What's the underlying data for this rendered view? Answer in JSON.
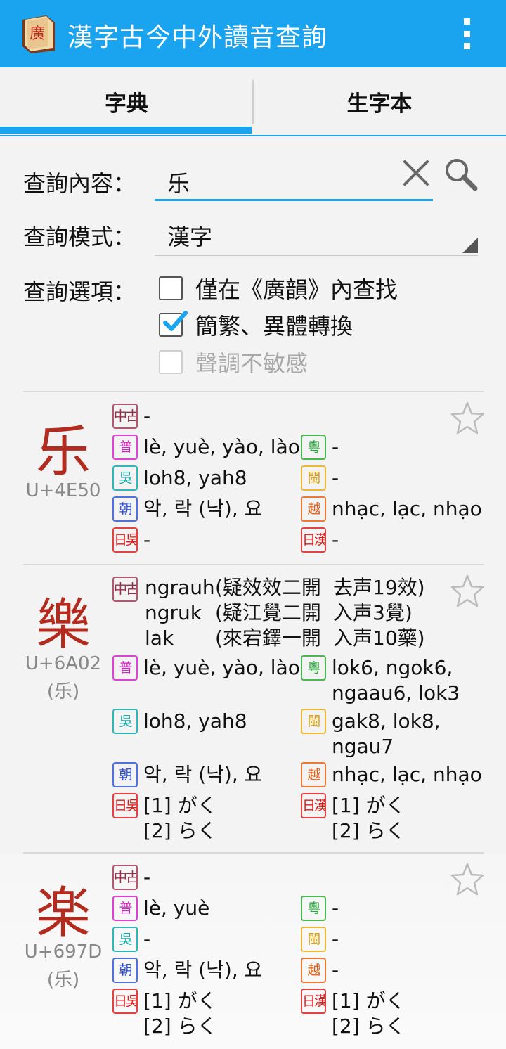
{
  "app": {
    "title": "漢字古今中外讀音查詢",
    "icon_char": "廣",
    "menu_icon": "overflow-menu-icon"
  },
  "tabs": [
    {
      "label": "字典",
      "selected": true
    },
    {
      "label": "生字本",
      "selected": false
    }
  ],
  "form": {
    "query_label": "查詢內容：",
    "query_value": "乐",
    "mode_label": "查詢模式：",
    "mode_value": "漢字",
    "options_label": "查詢選項：",
    "options": [
      {
        "label": "僅在《廣韻》內查找",
        "checked": false,
        "enabled": true
      },
      {
        "label": "簡繁、異體轉換",
        "checked": true,
        "enabled": true
      },
      {
        "label": "聲調不敏感",
        "checked": false,
        "enabled": false
      }
    ]
  },
  "badges": {
    "mc": "中古",
    "pu": "普",
    "wu": "吳",
    "cho": "朝",
    "jw": "日吳",
    "yue": "粵",
    "min": "閩",
    "viet": "越",
    "jk": "日漢"
  },
  "entries": [
    {
      "char": "乐",
      "code": "U+4E50",
      "simplified": "",
      "mc": "-",
      "pu": "lè, yuè, yào, lào",
      "wu": "loh8, yah8",
      "cho": "악, 락 (낙), 요",
      "jw": "-",
      "yue": "-",
      "min": "-",
      "viet": "nhạc, lạc, nhạo",
      "jk": "-"
    },
    {
      "char": "樂",
      "code": "U+6A02",
      "simplified": "(乐)",
      "mc_rows": [
        {
          "a": "ngrauh",
          "b": "(疑效效二開",
          "c": "去声19效)"
        },
        {
          "a": "ngruk",
          "b": "(疑江覺二開",
          "c": "入声3覺)"
        },
        {
          "a": "lak",
          "b": "(來宕鐸一開",
          "c": "入声10藥)"
        }
      ],
      "pu": "lè, yuè, yào, lào",
      "wu": "loh8, yah8",
      "cho": "악, 락 (낙), 요",
      "jw_1": "[1] がく",
      "jw_2": "[2] らく",
      "yue_1": "lok6, ngok6,",
      "yue_2": "ngaau6, lok3",
      "min_1": "gak8, lok8,",
      "min_2": "ngau7",
      "viet": "nhạc, lạc, nhạo",
      "jk_1": "[1] がく",
      "jk_2": "[2] らく"
    },
    {
      "char": "楽",
      "code": "U+697D",
      "simplified": "(乐)",
      "mc": "-",
      "pu": "lè, yuè",
      "wu": "-",
      "cho": "악, 락 (낙), 요",
      "jw_1": "[1] がく",
      "jw_2": "[2] らく",
      "yue": "-",
      "min": "-",
      "viet": "-",
      "jk_1": "[1] がく",
      "jk_2": "[2] らく"
    }
  ],
  "colors": {
    "accent": "#1aa3ee",
    "char_red": "#b22b1e"
  }
}
